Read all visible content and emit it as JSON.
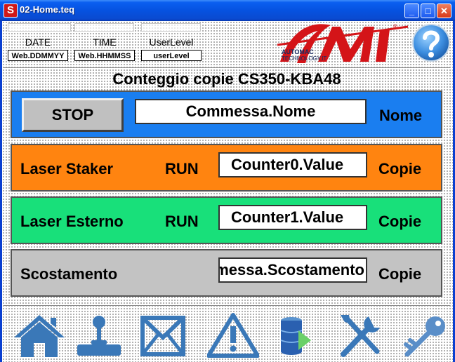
{
  "window": {
    "title": "02-Home.teq",
    "app_icon": "S",
    "minimize": "_",
    "maximize": "□",
    "close": "✕"
  },
  "header": {
    "date_label": "DATE",
    "date_value": "Web.DDMMYY",
    "time_label": "TIME",
    "time_value": "Web.HHMMSS",
    "user_label": "UserLevel",
    "user_value": "userLevel",
    "logo_icon": "ami-automac-logo",
    "help_icon": "help-icon"
  },
  "heading": "Conteggio copie CS350-KBA48",
  "rows": [
    {
      "color": "#1a7ef0",
      "button": "STOP",
      "value": "Commessa.Nome",
      "unit": "Nome"
    },
    {
      "color": "#ff8410",
      "name": "Laser Staker",
      "status": "RUN",
      "value": "Counter0.Value",
      "unit": "Copie"
    },
    {
      "color": "#18e07a",
      "name": "Laser Esterno",
      "status": "RUN",
      "value": "Counter1.Value",
      "unit": "Copie"
    },
    {
      "color": "#c3c3c3",
      "name": "Scostamento",
      "value": "Commessa.Scostamento",
      "unit": "Copie"
    }
  ],
  "toolbar": [
    "home-icon",
    "joystick-icon",
    "mail-icon",
    "warning-icon",
    "database-icon",
    "tools-icon",
    "key-icon"
  ],
  "colors": {
    "title_bar": "#0652e0",
    "blue": "#1a7ef0",
    "orange": "#ff8410",
    "green": "#18e07a",
    "gray": "#c3c3c3",
    "icon": "#3a78b8"
  }
}
